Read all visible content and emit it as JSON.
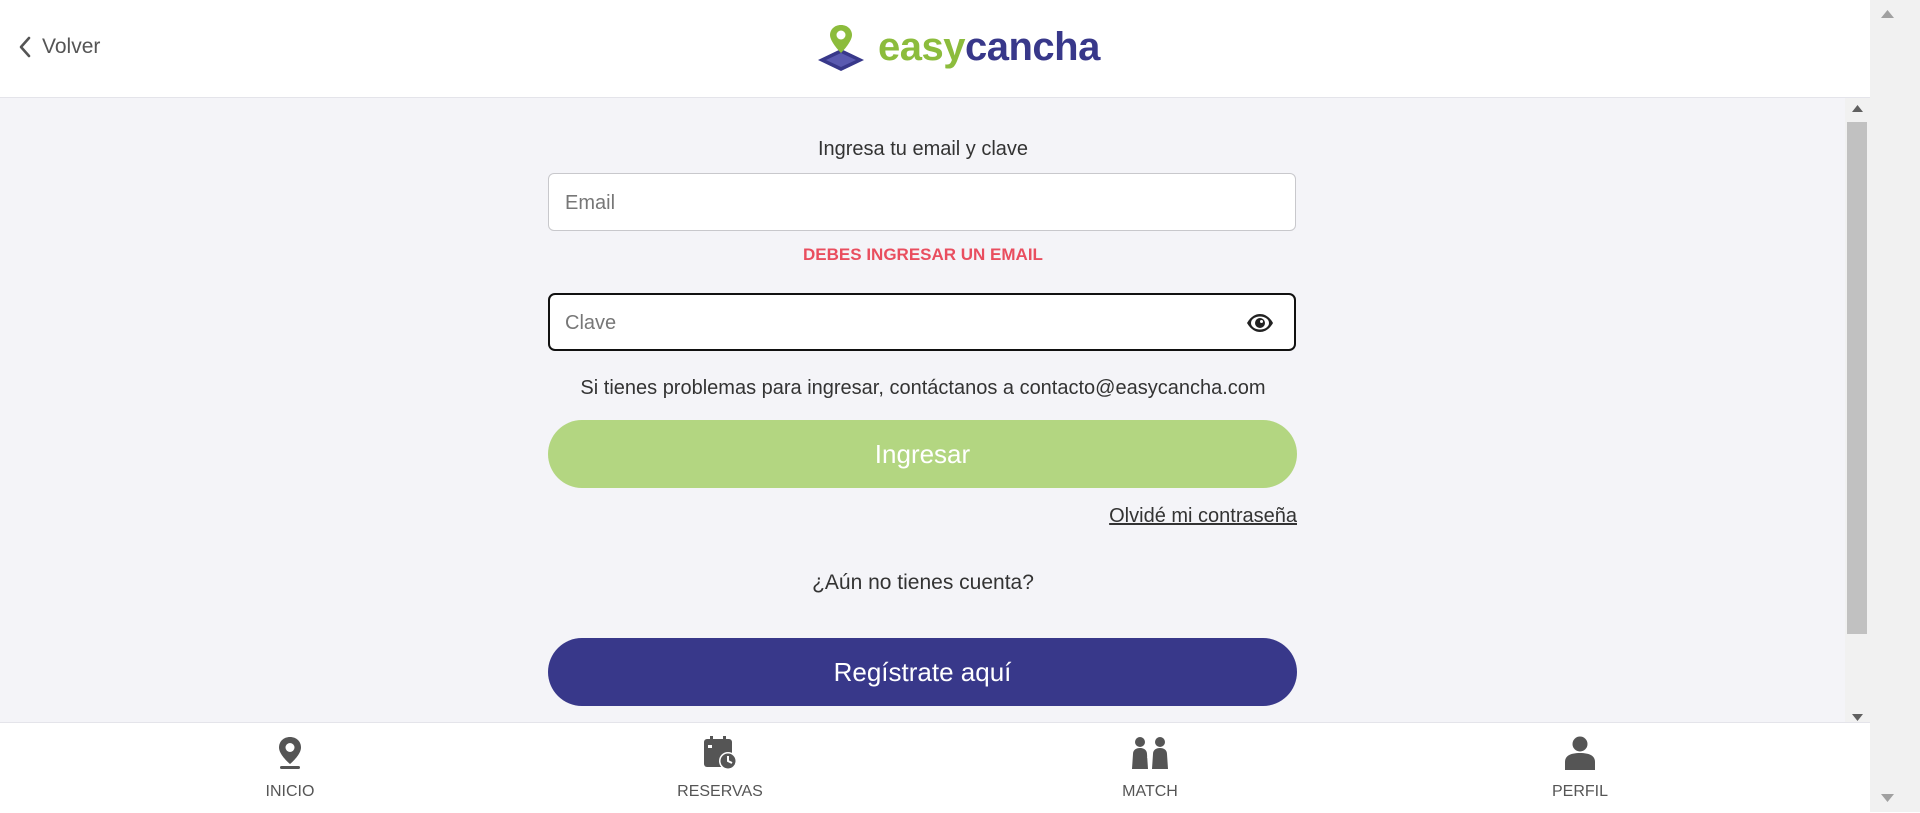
{
  "header": {
    "back_label": "Volver",
    "logo_easy": "easy",
    "logo_cancha": "cancha"
  },
  "form": {
    "prompt": "Ingresa tu email y clave",
    "email_placeholder": "Email",
    "email_value": "",
    "email_error": "DEBES INGRESAR UN EMAIL",
    "password_placeholder": "Clave",
    "password_value": "",
    "help_text": "Si tienes problemas para ingresar, contáctanos a contacto@easycancha.com",
    "login_label": "Ingresar",
    "forgot_label": "Olvidé mi contraseña",
    "no_account_text": "¿Aún no tienes cuenta?",
    "register_label": "Regístrate aquí"
  },
  "nav": {
    "items": [
      {
        "label": "INICIO",
        "icon": "location-pin-icon"
      },
      {
        "label": "RESERVAS",
        "icon": "calendar-clock-icon"
      },
      {
        "label": "MATCH",
        "icon": "match-players-icon"
      },
      {
        "label": "PERFIL",
        "icon": "user-profile-icon"
      }
    ]
  },
  "colors": {
    "brand_green": "#8cbc3c",
    "brand_navy": "#38388a",
    "login_button": "#b3d681",
    "error": "#e94e5f"
  }
}
